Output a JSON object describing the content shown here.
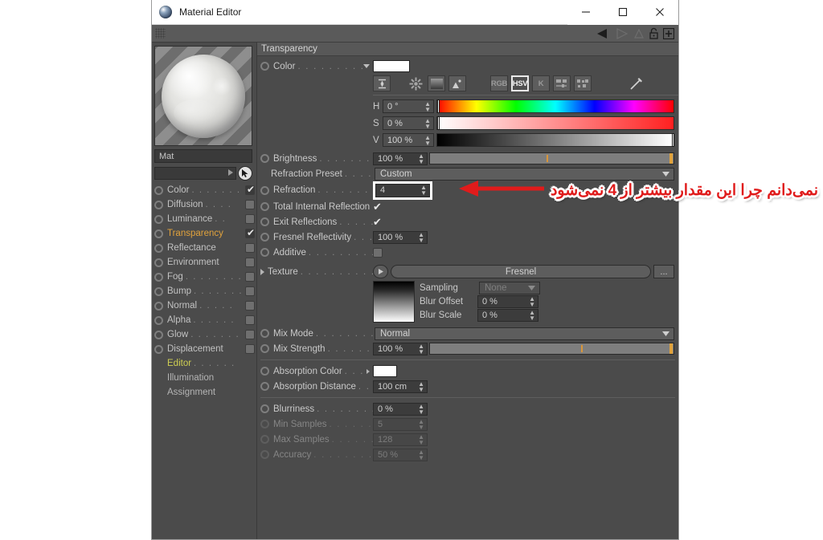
{
  "window": {
    "title": "Material Editor",
    "icon": "material-sphere-icon",
    "controls": {
      "minimize": "–",
      "maximize": "□",
      "close": "✕"
    }
  },
  "toolbar": {
    "grip": "drag-grip",
    "icons": [
      "back-arrow-icon",
      "forward-arrow-icon",
      "lock-icon",
      "plus-icon"
    ]
  },
  "material": {
    "preview_label": "material-preview",
    "name": "Mat",
    "search_value": ""
  },
  "channels": [
    {
      "label": "Color",
      "dots": ". . . . . . .",
      "checked": true,
      "enabled": true
    },
    {
      "label": "Diffusion",
      "dots": ". . . .",
      "checked": false,
      "enabled": true
    },
    {
      "label": "Luminance",
      "dots": ". .",
      "checked": false,
      "enabled": true
    },
    {
      "label": "Transparency",
      "dots": "",
      "checked": true,
      "enabled": true,
      "active": true
    },
    {
      "label": "Reflectance",
      "dots": "",
      "checked": false,
      "enabled": true
    },
    {
      "label": "Environment",
      "dots": "",
      "checked": false,
      "enabled": true
    },
    {
      "label": "Fog",
      "dots": ". . . . . . . .",
      "checked": false,
      "enabled": true
    },
    {
      "label": "Bump",
      "dots": ". . . . . . .",
      "checked": false,
      "enabled": true
    },
    {
      "label": "Normal",
      "dots": ". . . . .",
      "checked": false,
      "enabled": true
    },
    {
      "label": "Alpha",
      "dots": ". . . . . .",
      "checked": false,
      "enabled": true
    },
    {
      "label": "Glow",
      "dots": ". . . . . . .",
      "checked": false,
      "enabled": true
    },
    {
      "label": "Displacement",
      "dots": "",
      "checked": false,
      "enabled": true
    }
  ],
  "subchannels": [
    {
      "label": "Editor",
      "dots": ". . . . . .",
      "active": true
    },
    {
      "label": "Illumination",
      "dots": "",
      "active": false
    },
    {
      "label": "Assignment",
      "dots": "",
      "active": false
    }
  ],
  "section": {
    "title": "Transparency"
  },
  "color": {
    "label": "Color",
    "dots": ". . . . . . . . . . . .",
    "swatch_hex": "#ffffff",
    "mode_icons": [
      {
        "name": "eyedropper-range-icon",
        "glyph": "⌶"
      },
      {
        "name": "color-wheel-icon",
        "glyph": "✺"
      },
      {
        "name": "gradient-icon",
        "glyph": "▨"
      },
      {
        "name": "image-picker-icon",
        "glyph": "⛰"
      }
    ],
    "mode_buttons": [
      {
        "label": "RGB",
        "selected": false
      },
      {
        "label": "HSV",
        "selected": true
      },
      {
        "label": "K",
        "selected": false
      }
    ],
    "extra_icons": [
      {
        "name": "sliders-icon",
        "glyph": "▤"
      },
      {
        "name": "swatches-icon",
        "glyph": "▩"
      },
      {
        "name": "pipette-icon",
        "glyph": "✎"
      }
    ],
    "hsv": [
      {
        "channel": "H",
        "value": "0 °",
        "cursor_pct": 0
      },
      {
        "channel": "S",
        "value": "0 %",
        "cursor_pct": 0
      },
      {
        "channel": "V",
        "value": "100 %",
        "cursor_pct": 100
      }
    ]
  },
  "properties": {
    "brightness": {
      "label": "Brightness",
      "dots": ". . . . . . . . . .",
      "value": "100 %",
      "slider_pct": 100
    },
    "refraction_preset": {
      "label": "Refraction Preset",
      "dots": ". . . . . .",
      "value": "Custom"
    },
    "refraction": {
      "label": "Refraction",
      "dots": ". . . . . . . . . .",
      "value": "4",
      "highlighted": true
    },
    "total_internal_reflection": {
      "label": "Total Internal Reflection",
      "dots": "",
      "checked": true
    },
    "exit_reflections": {
      "label": "Exit Reflections",
      "dots": ". . . . . . .",
      "checked": true
    },
    "fresnel_reflectivity": {
      "label": "Fresnel Reflectivity",
      "dots": ". . . .",
      "value": "100 %"
    },
    "additive": {
      "label": "Additive",
      "dots": ". . . . . . . . . . .",
      "checked": false
    },
    "texture": {
      "label": "Texture",
      "dots": ". . . . . . . . . . .",
      "value": "Fresnel",
      "more": "..."
    },
    "sampling": {
      "label": "Sampling",
      "value": "None",
      "disabled": true
    },
    "blur_offset": {
      "label": "Blur Offset",
      "value": "0 %"
    },
    "blur_scale": {
      "label": "Blur Scale",
      "value": "0 %"
    },
    "mix_mode": {
      "label": "Mix Mode",
      "dots": ". . . . . . . . . .",
      "value": "Normal"
    },
    "mix_strength": {
      "label": "Mix Strength",
      "dots": ". . . . . . . . .",
      "value": "100 %",
      "slider_pct": 100
    },
    "absorption_color": {
      "label": "Absorption Color",
      "dots": ". . .",
      "swatch_hex": "#ffffff"
    },
    "absorption_distance": {
      "label": "Absorption Distance",
      "dots": ". . .",
      "value": "100 cm"
    },
    "blurriness": {
      "label": "Blurriness",
      "dots": ". . . . . . . . . . .",
      "value": "0 %",
      "disabled": false
    },
    "min_samples": {
      "label": "Min Samples",
      "dots": ". . . . . . . . .",
      "value": "5",
      "disabled": true
    },
    "max_samples": {
      "label": "Max Samples",
      "dots": ". . . . . . . . .",
      "value": "128",
      "disabled": true
    },
    "accuracy": {
      "label": "Accuracy",
      "dots": ". . . . . . . . . . .",
      "value": "50 %",
      "disabled": true
    }
  },
  "annotation": {
    "text": "نمی‌دانم چرا این مقدار بیشتر از 4 نمی‌شود",
    "color": "#e01b1b",
    "arrow": "left-arrow-annotation"
  }
}
